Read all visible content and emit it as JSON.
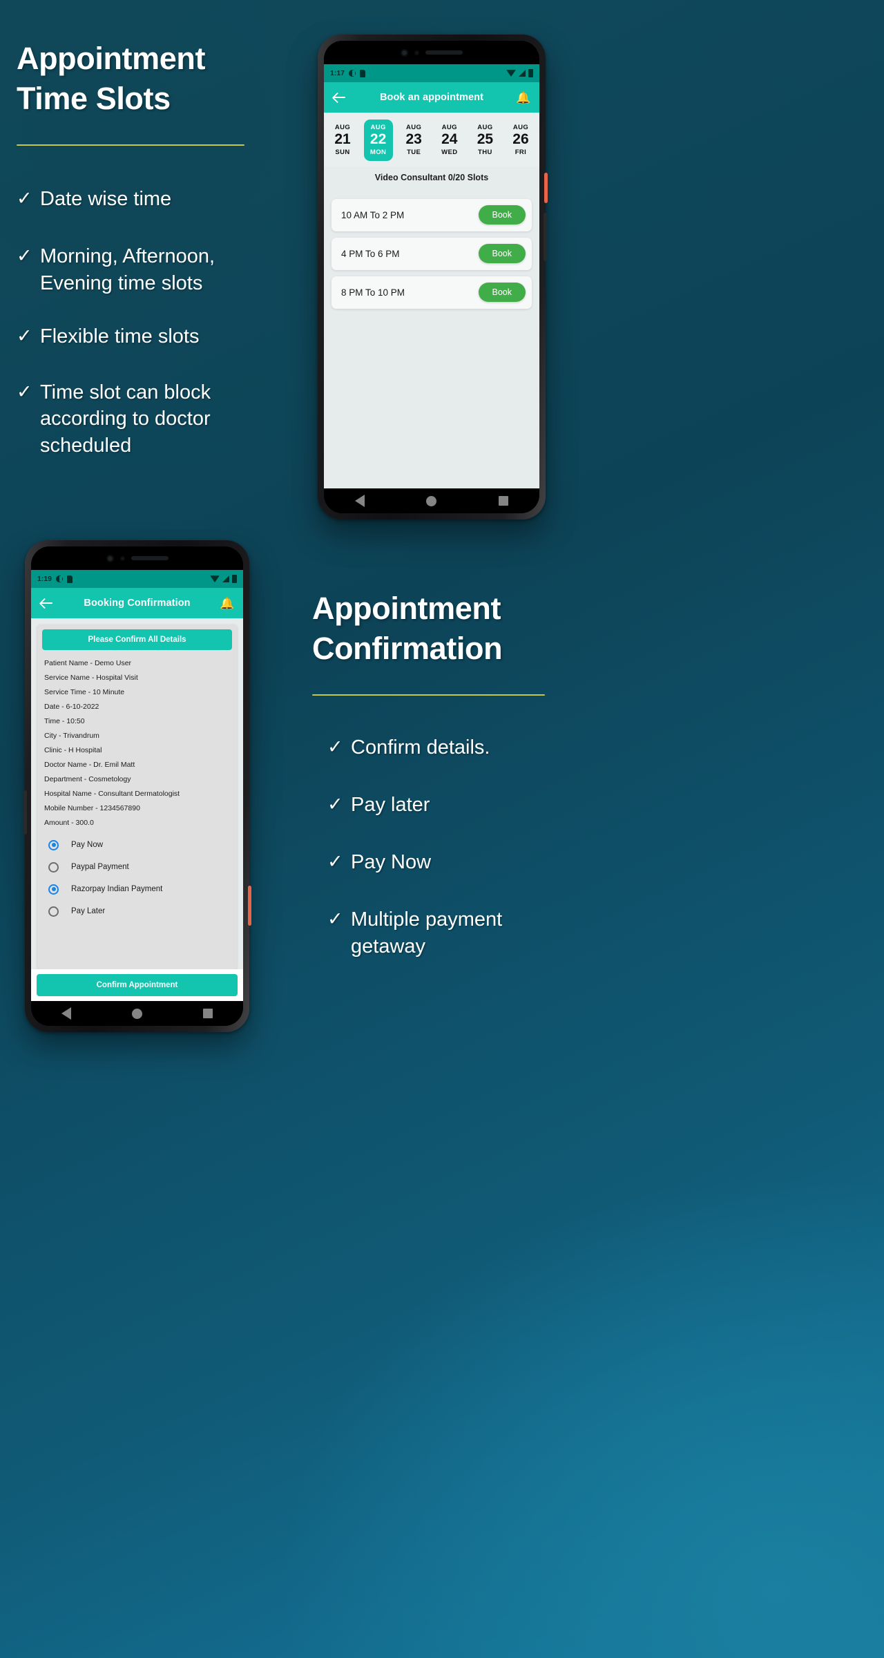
{
  "theme": {
    "background_deep": "#0d4357",
    "background_light": "#1579a0",
    "accent_teal": "#13c4ae",
    "statusbar_teal": "#009688",
    "rule_yellow": "#d7d34a",
    "book_green": "#41ad49",
    "radio_blue": "#1a83e8",
    "power_button_orange": "#e8654a"
  },
  "section_top": {
    "headline": "Appointment\nTime Slots",
    "bullets": [
      {
        "tick": "✓",
        "text": "Date wise time"
      },
      {
        "tick": "✓",
        "text": "Morning, Afternoon,\nEvening time slots"
      },
      {
        "tick": "✓",
        "text": "Flexible time slots"
      },
      {
        "tick": "✓",
        "text": " Time slot can block\naccording to doctor\nscheduled"
      }
    ]
  },
  "section_bottom": {
    "headline": "Appointment\nConfirmation",
    "bullets": [
      {
        "tick": "✓",
        "text": "Confirm details."
      },
      {
        "tick": "✓",
        "text": "Pay later"
      },
      {
        "tick": "✓",
        "text": "Pay Now"
      },
      {
        "tick": "✓",
        "text": "Multiple payment\ngetaway"
      }
    ]
  },
  "phone_booking": {
    "statusbar": {
      "time": "1:17"
    },
    "appbar": {
      "back_icon": "arrow-left-icon",
      "title": "Book an appointment",
      "bell_icon": "bell-icon"
    },
    "dates": [
      {
        "month": "AUG",
        "day": "21",
        "dow": "SUN",
        "selected": false
      },
      {
        "month": "AUG",
        "day": "22",
        "dow": "MON",
        "selected": true
      },
      {
        "month": "AUG",
        "day": "23",
        "dow": "TUE",
        "selected": false
      },
      {
        "month": "AUG",
        "day": "24",
        "dow": "WED",
        "selected": false
      },
      {
        "month": "AUG",
        "day": "25",
        "dow": "THU",
        "selected": false
      },
      {
        "month": "AUG",
        "day": "26",
        "dow": "FRI",
        "selected": false
      }
    ],
    "slots_note": "Video Consultant 0/20 Slots",
    "slots": [
      {
        "time": "10 AM To 2 PM",
        "button": "Book"
      },
      {
        "time": "4 PM To 6 PM",
        "button": "Book"
      },
      {
        "time": "8 PM To 10 PM",
        "button": "Book"
      }
    ],
    "navbar": {
      "back": "nav-back-icon",
      "home": "nav-home-icon",
      "recent": "nav-recent-icon"
    }
  },
  "phone_confirmation": {
    "statusbar": {
      "time": "1:19"
    },
    "appbar": {
      "back_icon": "arrow-left-icon",
      "title": "Booking Confirmation",
      "bell_icon": "bell-icon"
    },
    "card_header": "Please Confirm All Details",
    "details": [
      "Patient Name - Demo User",
      "Service Name - Hospital Visit",
      "Service Time - 10 Minute",
      "Date - 6-10-2022",
      "Time - 10:50",
      "City - Trivandrum",
      "Clinic - H Hospital",
      "Doctor Name - Dr. Emil Matt",
      "Department - Cosmetology",
      "Hospital Name - Consultant Dermatologist",
      "Mobile Number - 1234567890",
      "Amount - 300.0"
    ],
    "payment_options": [
      {
        "label": "Pay Now",
        "selected": true
      },
      {
        "label": "Paypal Payment",
        "selected": false
      },
      {
        "label": "Razorpay Indian Payment",
        "selected": true
      },
      {
        "label": "Pay Later",
        "selected": false
      }
    ],
    "confirm_button": "Confirm Appointment",
    "navbar": {
      "back": "nav-back-icon",
      "home": "nav-home-icon",
      "recent": "nav-recent-icon"
    }
  }
}
